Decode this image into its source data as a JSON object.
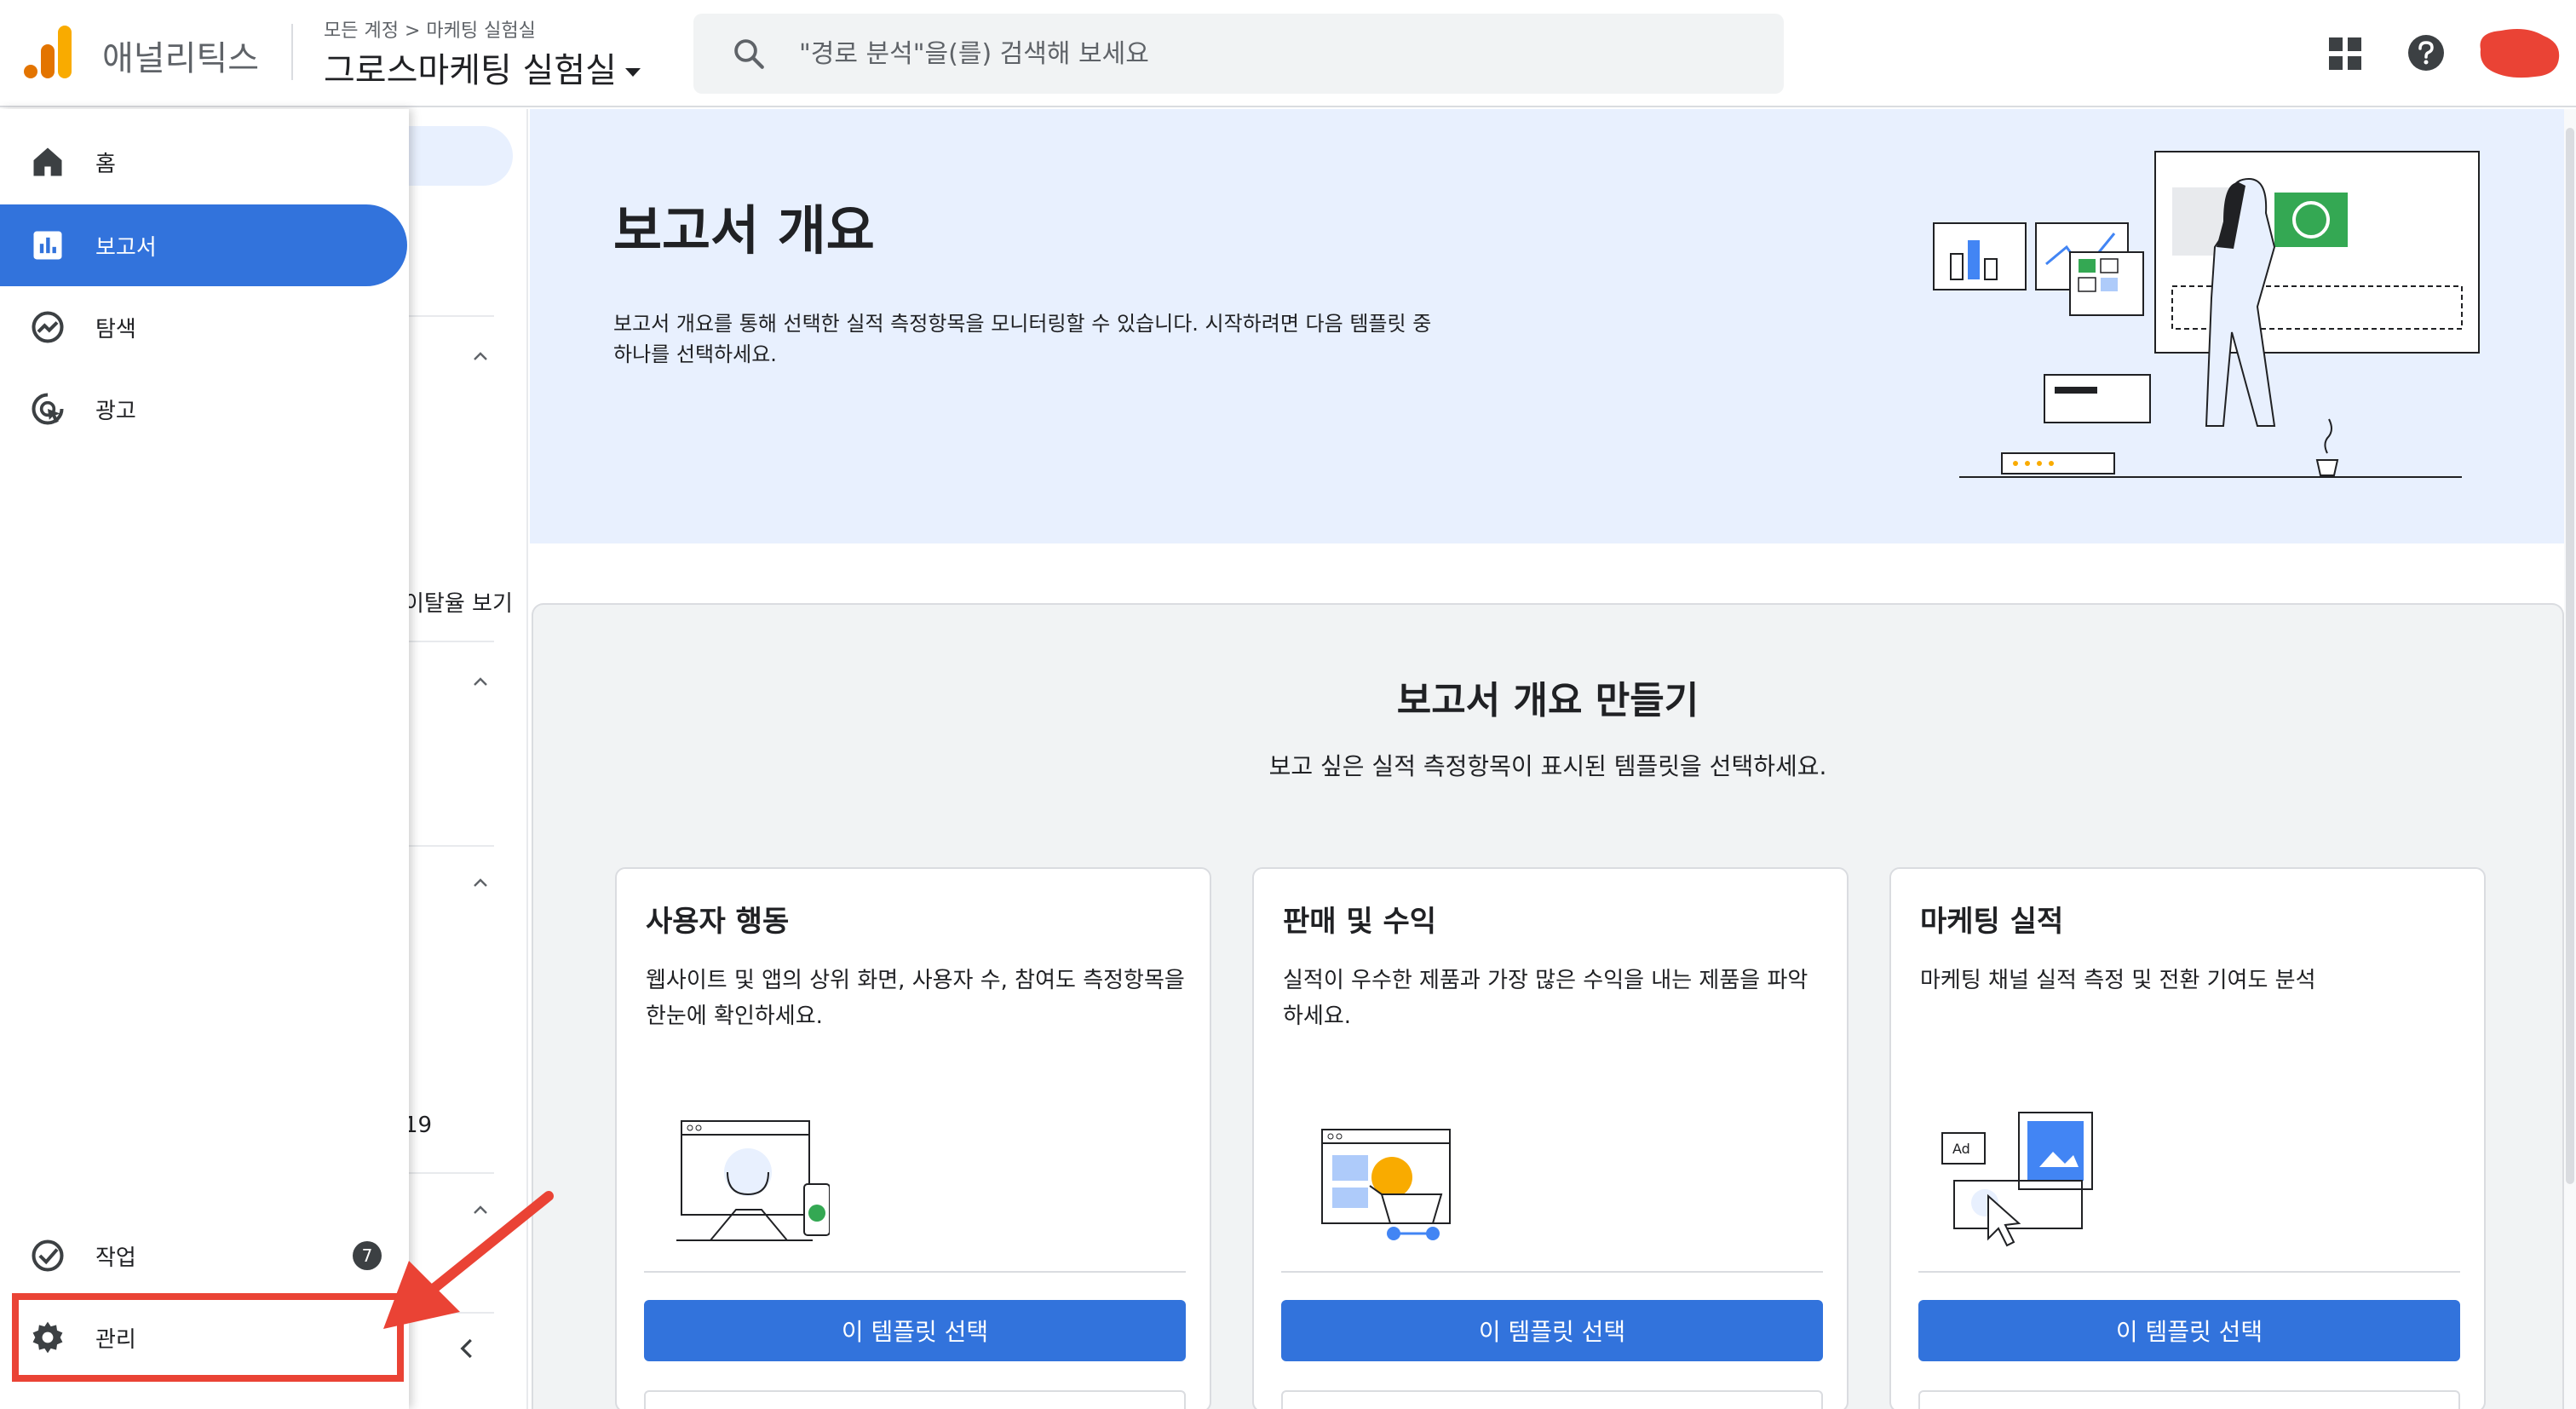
{
  "header": {
    "app_name": "애널리틱스",
    "breadcrumb": "모든 계정 > 마케팅 실험실",
    "property": "그로스마케팅 실험실",
    "search_placeholder": "\"경로 분석\"을(를) 검색해 보세요"
  },
  "drawer": {
    "items": [
      {
        "label": "홈",
        "icon": "home-icon"
      },
      {
        "label": "보고서",
        "icon": "reports-icon"
      },
      {
        "label": "탐색",
        "icon": "explore-icon"
      },
      {
        "label": "광고",
        "icon": "advertising-icon"
      }
    ],
    "tasks_label": "작업",
    "tasks_badge": "7",
    "admin_label": "관리"
  },
  "subnav": {
    "partial_text_1": "​이탈율 보기",
    "partial_text_2": "19"
  },
  "hero": {
    "title": "보고서 개요",
    "description": "보고서 개요를 통해 선택한 실적 측정항목을 모니터링할 수 있습니다. 시작하려면 다음 템플릿 중 하나를 선택하세요."
  },
  "builder": {
    "title": "보고서 개요 만들기",
    "subtitle": "보고 싶은 실적 측정항목이 표시된 템플릿을 선택하세요.",
    "cards": [
      {
        "title": "사용자 행동",
        "description": "웹사이트 및 앱의 상위 화면, 사용자 수, 참여도 측정항목을 한눈에 확인하세요.",
        "button": "이 템플릿 선택"
      },
      {
        "title": "판매 및 수익",
        "description": "실적이 우수한 제품과 가장 많은 수익을 내는 제품을 파악하세요.",
        "button": "이 템플릿 선택"
      },
      {
        "title": "마케팅 실적",
        "description": "마케팅 채널 실적 측정 및 전환 기여도 분석",
        "button": "이 템플릿 선택"
      }
    ],
    "ad_label": "Ad"
  },
  "colors": {
    "primary": "#3273dc",
    "annotation": "#ea4335",
    "hero_bg": "#e8f0fe"
  }
}
